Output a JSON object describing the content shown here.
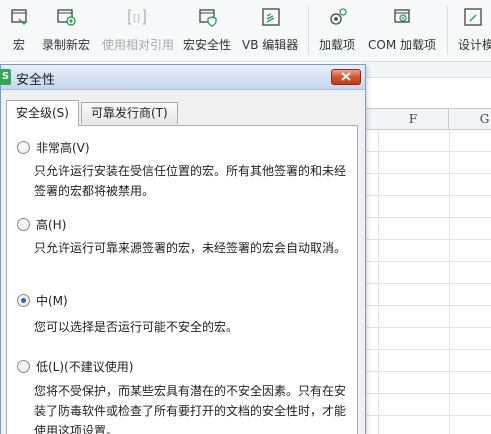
{
  "ribbon": {
    "items": [
      {
        "label": "宏",
        "icon": "macro-icon",
        "disabled": false
      },
      {
        "label": "录制新宏",
        "icon": "record-macro-icon",
        "disabled": false
      },
      {
        "label": "使用相对引用",
        "icon": "relative-reference-icon",
        "disabled": true
      },
      {
        "label": "宏安全性",
        "icon": "macro-security-icon",
        "disabled": false
      },
      {
        "label": "VB 编辑器",
        "icon": "vb-editor-icon",
        "disabled": false
      },
      {
        "label": "加载项",
        "icon": "addins-icon",
        "disabled": false
      },
      {
        "label": "COM 加载项",
        "icon": "com-addins-icon",
        "disabled": false
      },
      {
        "label": "设计模",
        "icon": "design-mode-icon",
        "disabled": false
      }
    ]
  },
  "sheet": {
    "column_headers": [
      "F",
      "G"
    ]
  },
  "dialog": {
    "app_icon_text": "S",
    "title": "安全性",
    "tabs": [
      {
        "label": "安全级(S)",
        "active": true
      },
      {
        "label": "可靠发行商(T)",
        "active": false
      }
    ],
    "options": [
      {
        "label": "非常高(V)",
        "checked": false,
        "description": "只允许运行安装在受信任位置的宏。所有其他签署的和未经签署的宏都将被禁用。"
      },
      {
        "label": "高(H)",
        "checked": false,
        "description": "只允许运行可靠来源签署的宏，未经签署的宏会自动取消。"
      },
      {
        "label": "中(M)",
        "checked": true,
        "description": "您可以选择是否运行可能不安全的宏。"
      },
      {
        "label": "低(L)(不建议使用)",
        "checked": false,
        "description": "您将不受保护，而某些宏具有潜在的不安全因素。只有在安装了防毒软件或检查了所有要打开的文档的安全性时，才能使用这项设置。"
      }
    ]
  },
  "colors": {
    "accent_blue": "#2b64c8",
    "close_red": "#d2542f",
    "app_icon_green": "#2fa84f"
  }
}
